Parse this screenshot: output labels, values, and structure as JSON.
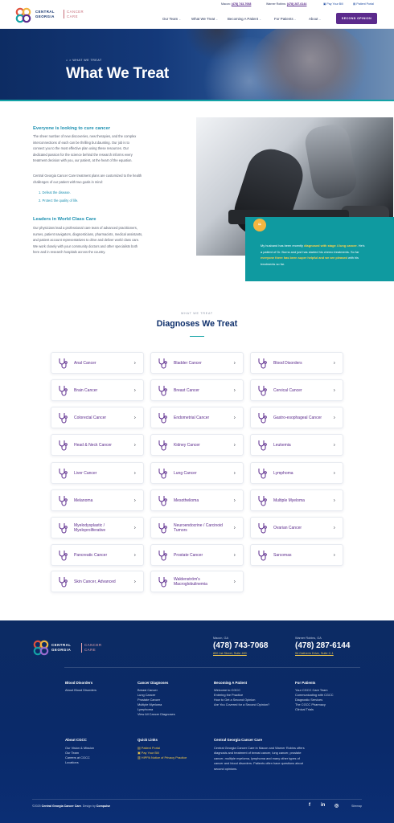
{
  "header": {
    "logo_line1": "CENTRAL",
    "logo_line2": "GEORGIA",
    "logo_sub1": "CANCER",
    "logo_sub2": "CARE",
    "macon_label": "Macon:",
    "macon_phone": "(478) 743-7068",
    "wr_label": "Warner Robins:",
    "wr_phone": "(478) 287-6144",
    "pay_bill": "Pay Your Bill",
    "patient_portal": "Patient Portal",
    "nav": [
      "Our Team",
      "What We Treat",
      "Becoming A Patient",
      "For Patients",
      "About"
    ],
    "cta": "SECOND OPINION"
  },
  "hero": {
    "crumb_sep": ">",
    "crumb": "WHAT WE TREAT",
    "title": "What We Treat"
  },
  "intro": {
    "h1": "Everyone is looking to cure cancer",
    "p1_lines": [
      "The sheer number of new discoveries, new therapies, and the complex",
      "interconnections of each can be thrilling but daunting. Our job is to",
      "connect you to the most effective plan using these resources. Our",
      "dedicated passion for the science behind the research informs every",
      "treatment decision with you, our patient, at the heart of the equation."
    ],
    "p2_lines": [
      "Central Georgia Cancer Care treatment plans are customized to the health",
      "challenges of our patient with two goals in mind:"
    ],
    "goals": [
      "1. Defeat the disease.",
      "2. Protect the quality of life."
    ],
    "h2": "Leaders in World Class Care",
    "p3_lines": [
      "Our physicians lead a professional care team of advanced practitioners,",
      "nurses, patient navigators, diagnosticians, pharmacists, medical assistants,",
      "and patient account representatives to drive and deliver world class care.",
      "We work closely with your community doctors and other specialists both",
      "here and in research hospitals across the country."
    ]
  },
  "quote": {
    "icon": "“",
    "l1a": "My husband has been recently ",
    "l1b": "diagnosed with stage 4 lung cancer.",
    "l1c": " He's",
    "l2": "a patient of Dr. Burns and just has started his chemo treatments. So far",
    "l3a": "everyone there has been super helpful and we are pleased",
    "l3b": " with his",
    "l4": "treatments so far."
  },
  "diagnoses": {
    "eyebrow": "WHAT WE TREAT",
    "title": "Diagnoses We Treat",
    "items": [
      "Anal Cancer",
      "Bladder Cancer",
      "Blood Disorders",
      "Brain Cancer",
      "Breast Cancer",
      "Cervical Cancer",
      "Colorectal Cancer",
      "Endometrial Cancer",
      "Gastro-esophageal Cancer",
      "Head & Neck Cancer",
      "Kidney Cancer",
      "Leukemia",
      "Liver Cancer",
      "Lung Cancer",
      "Lymphoma",
      "Melanoma",
      "Mesothelioma",
      "Multiple Myeloma",
      "Myelodysplastic / Myeloproliferative",
      "Neuroendocrine / Carcinoid Tumors",
      "Ovarian Cancer",
      "Pancreatic Cancer",
      "Prostate Cancer",
      "Sarcomas",
      "Skin Cancer, Advanced",
      "Waldenström's Macroglobulinemia"
    ]
  },
  "footer": {
    "logo_line1": "CENTRAL",
    "logo_line2": "GEORGIA",
    "logo_sub1": "CANCER",
    "logo_sub2": "CARE",
    "macon_city": "Macon, GA",
    "macon_phone": "(478) 743-7068",
    "macon_addr": "800 1st Street, Suite 400",
    "wr_city": "Warner Robins, GA",
    "wr_phone": "(478) 287-6144",
    "wr_addr": "94 Gatherin Drive, Suite C-1",
    "col1_head": "Blood Disorders",
    "col1": [
      "About Blood Disorders"
    ],
    "col2_head": "Cancer Diagnoses",
    "col2": [
      "Breast Cancer",
      "Lung Cancer",
      "Prostate Cancer",
      "Multiple Myeloma",
      "Lymphoma",
      "View All Cancer Diagnoses"
    ],
    "col3_head": "Becoming A Patient",
    "col3": [
      "Welcome to CGCC",
      "Entering the Practice",
      "How to Get a Second Opinion",
      "Are You Covered for a Second Opinion?"
    ],
    "col4_head": "For Patients",
    "col4": [
      "Your CGCC Care Team",
      "Communicating with CGCC",
      "Diagnostic Services",
      "The CGCC Pharmacy",
      "Clinical Trials"
    ],
    "about_head": "About CGCC",
    "about": [
      "Our Vision & Mission",
      "Our Team",
      "Careers at CGCC",
      "Locations"
    ],
    "quick_head": "Quick Links",
    "quick": [
      "Patient Portal",
      "Pay Your Bill",
      "HIPPA Notice of Privacy Practice"
    ],
    "cgcc_head": "Central Georgia Cancer Care",
    "cgcc_lines": [
      "Central Georgia Cancer Care in Macon and Warner Robins offers",
      "diagnosis and treatment of breast cancer, lung cancer, prostate",
      "cancer, multiple myeloma, lymphoma and many other types of",
      "cancer and blood disorders. Patients often have questions about",
      "second opinions."
    ],
    "copy_a": "©2025 ",
    "copy_b": "Central Georgia Cancer Care",
    "copy_c": ". Design by ",
    "copy_d": "Compulse",
    "social": [
      "f",
      "in",
      "◎"
    ],
    "sitemap": "Sitemap"
  }
}
